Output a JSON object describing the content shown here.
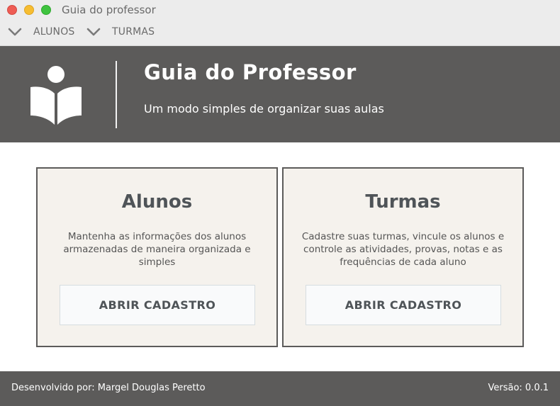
{
  "window": {
    "title": "Guia do professor"
  },
  "menu": {
    "items": [
      {
        "label": "ALUNOS",
        "icon": "chevron-down-icon"
      },
      {
        "label": "TURMAS",
        "icon": "chevron-down-icon"
      }
    ]
  },
  "header": {
    "title": "Guia do Professor",
    "subtitle": "Um modo simples de organizar suas aulas",
    "logo_icon": "reading-person-book-icon"
  },
  "cards": [
    {
      "title": "Alunos",
      "description": "Mantenha as informações dos alunos armazenadas de maneira organizada e simples",
      "button_label": "ABRIR CADASTRO"
    },
    {
      "title": "Turmas",
      "description": "Cadastre suas turmas, vincule os alunos e controle as atividades, provas, notas e as frequências de cada aluno",
      "button_label": "ABRIR CADASTRO"
    }
  ],
  "footer": {
    "developer": "Desenvolvido por: Margel Douglas Peretto",
    "version": "Versão: 0.0.1"
  },
  "colors": {
    "header_bg": "#5c5b5a",
    "card_bg": "#f5f2ed",
    "card_border": "#5c5b5a",
    "button_bg": "#f9fafb",
    "text_dark": "#4f5458"
  }
}
